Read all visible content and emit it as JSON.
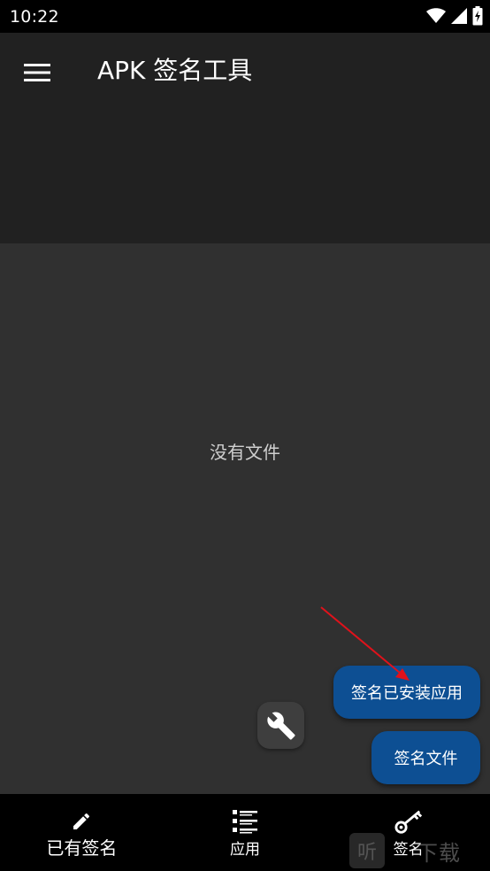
{
  "status_bar": {
    "time": "10:22",
    "icons": [
      "signal-icon",
      "wifi-icon",
      "battery-charging-icon"
    ]
  },
  "app_bar": {
    "title": "APK 签名工具",
    "menu_icon": "hamburger-menu-icon"
  },
  "content": {
    "empty_text": "没有文件"
  },
  "fabs": {
    "tools_icon": "wrench-icon",
    "sign_installed_label": "签名已安装应用",
    "sign_file_label": "签名文件"
  },
  "bottom_nav": {
    "items": [
      {
        "label": "已有签名",
        "icon": "pencil-icon"
      },
      {
        "label": "应用",
        "icon": "list-icon"
      },
      {
        "label": "签名",
        "icon": "key-icon"
      }
    ]
  },
  "watermark": {
    "logo": "听",
    "text": "下载"
  },
  "colors": {
    "background": "#303030",
    "app_bar": "#212121",
    "accent": "#0d4f93",
    "arrow": "#e0121b"
  }
}
